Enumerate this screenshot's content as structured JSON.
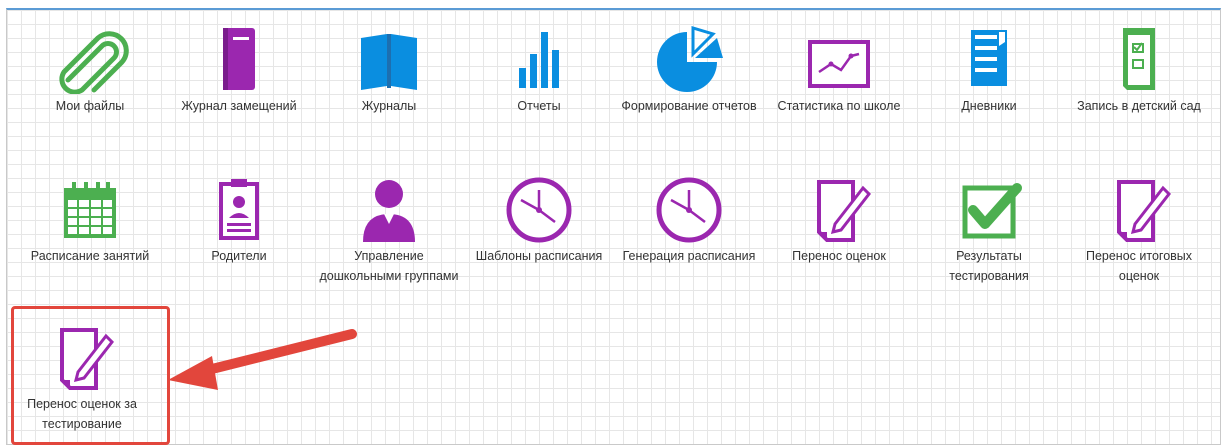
{
  "tiles": [
    {
      "label": "Мои файлы",
      "icon": "paperclip-icon"
    },
    {
      "label": "Журнал замещений",
      "icon": "journal-book-icon"
    },
    {
      "label": "Журналы",
      "icon": "open-book-icon"
    },
    {
      "label": "Отчеты",
      "icon": "bar-chart-icon"
    },
    {
      "label": "Формирование отчетов",
      "icon": "pie-chart-icon"
    },
    {
      "label": "Статистика по школе",
      "icon": "line-chart-icon"
    },
    {
      "label": "Дневники",
      "icon": "diary-notebook-icon"
    },
    {
      "label": "Запись в детский сад",
      "icon": "checklist-document-icon"
    },
    {
      "label": "Расписание занятий",
      "icon": "calendar-icon"
    },
    {
      "label": "Родители",
      "icon": "id-badge-icon"
    },
    {
      "label": "Управление дошкольными группами",
      "icon": "person-icon"
    },
    {
      "label": "Шаблоны расписания",
      "icon": "clock-icon"
    },
    {
      "label": "Генерация расписания",
      "icon": "clock-icon"
    },
    {
      "label": "Перенос оценок",
      "icon": "document-pencil-icon"
    },
    {
      "label": "Результаты тестирования",
      "icon": "checkmark-icon"
    },
    {
      "label": "Перенос итоговых оценок",
      "icon": "document-pencil-icon"
    },
    {
      "label": "Перенос оценок за тестирование",
      "icon": "document-pencil-icon"
    }
  ],
  "colors": {
    "green": "#4caf50",
    "purple": "#9b27af",
    "blue": "#0a8ee0",
    "highlight": "#e2463c"
  }
}
